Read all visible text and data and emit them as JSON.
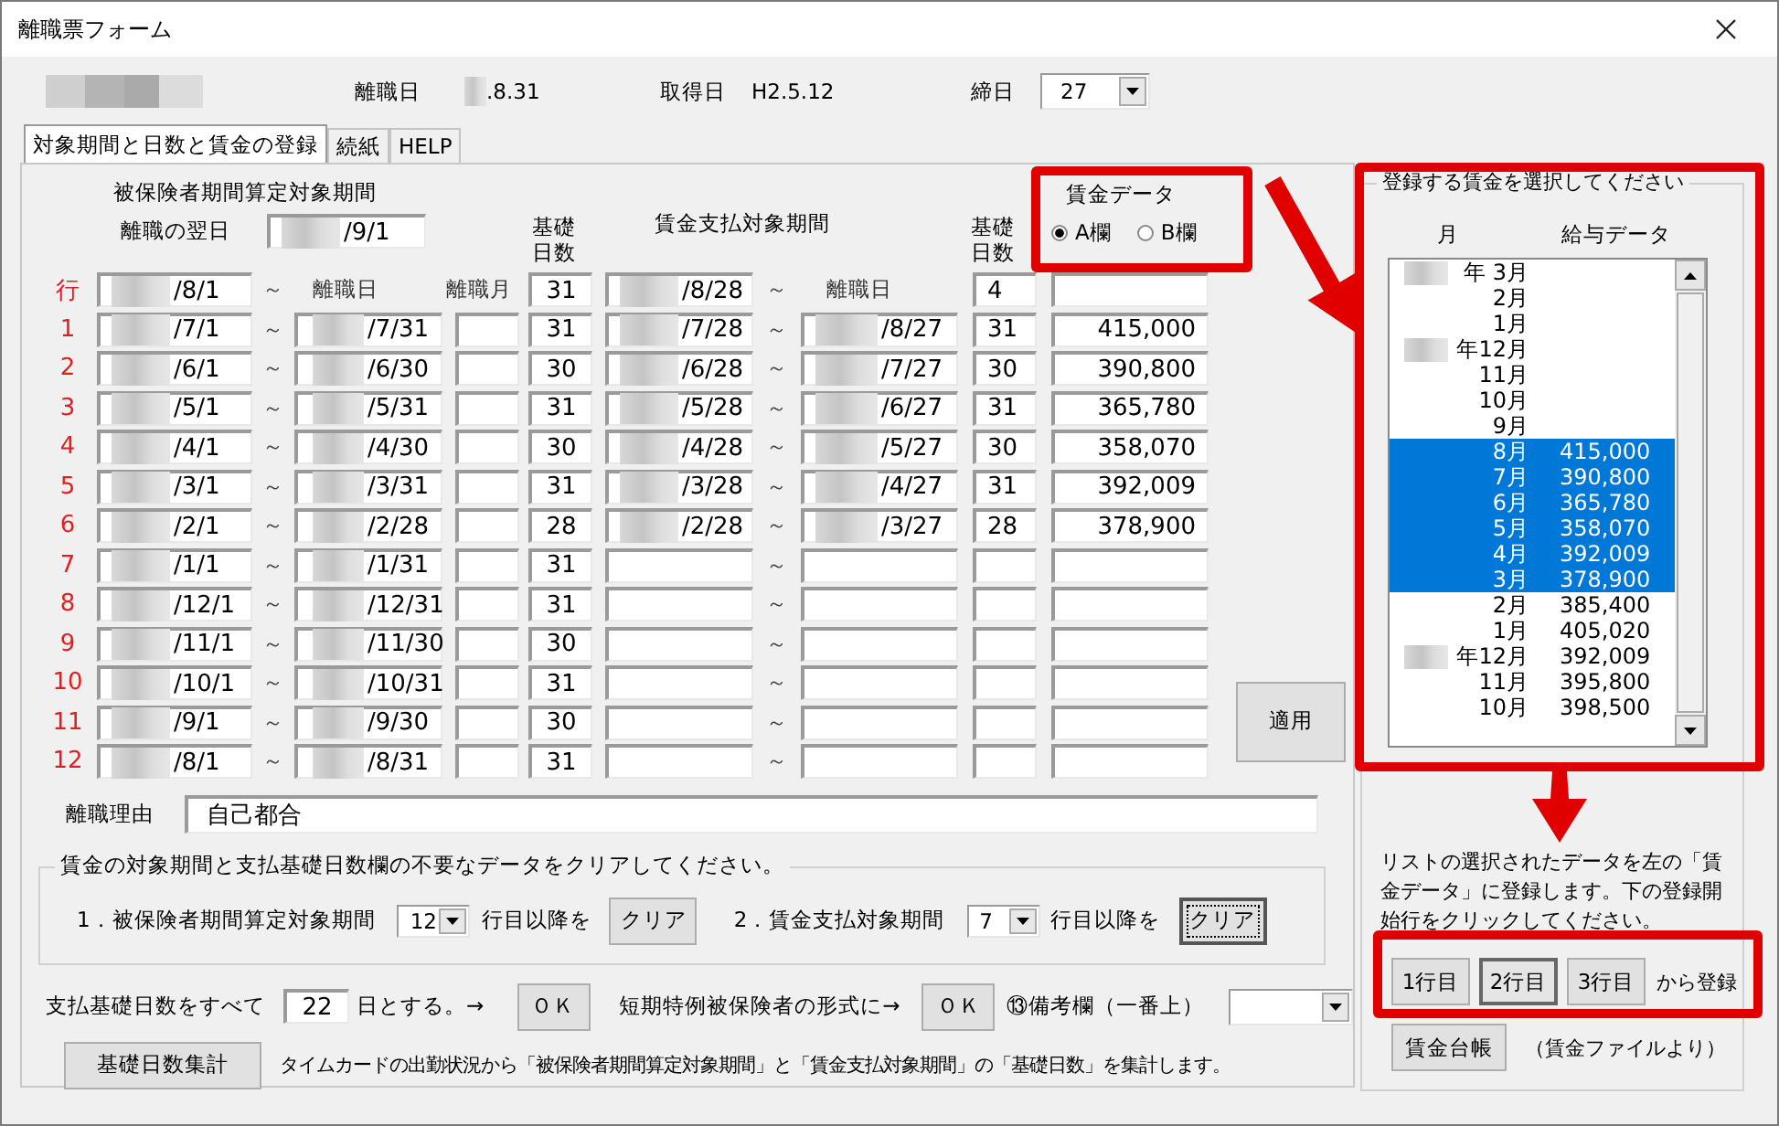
{
  "window": {
    "title": "離職票フォーム"
  },
  "header": {
    "separation_label": "離職日",
    "separation_date": ".8.31",
    "acquired_label": "取得日",
    "acquired_date": "H2.5.12",
    "closing_label": "締日",
    "closing_day": "27"
  },
  "tabs": [
    {
      "label": "対象期間と日数と賃金の登録",
      "selected": true
    },
    {
      "label": "続紙",
      "selected": false
    },
    {
      "label": "HELP",
      "selected": false
    }
  ],
  "period_heading": "被保険者期間算定対象期間",
  "next_day_label": "離職の翌日",
  "next_day": "/9/1",
  "days_heading": "基礎日数",
  "pay_period_heading": "賃金支払対象期間",
  "pay_days_heading": "基礎日数",
  "wage_data": {
    "title": "賃金データ",
    "options": [
      {
        "label": "A欄",
        "selected": true
      },
      {
        "label": "B欄",
        "selected": false
      }
    ]
  },
  "rows": [
    {
      "label": "行",
      "from": "/8/1",
      "from_sep": "～",
      "to_label": "離職日",
      "month_label": "離職月",
      "days": "31",
      "pay_from": "/8/28",
      "pay_sep": "～",
      "pay_to_label": "離職日",
      "pay_days": "4"
    },
    {
      "label": "1",
      "from": "/7/1",
      "from_sep": "～",
      "to": "/7/31",
      "days": "31",
      "pay_from": "/7/28",
      "pay_sep": "～",
      "pay_to": "/8/27",
      "pay_days": "31",
      "wage": "415,000"
    },
    {
      "label": "2",
      "from": "/6/1",
      "from_sep": "～",
      "to": "/6/30",
      "days": "30",
      "pay_from": "/6/28",
      "pay_sep": "～",
      "pay_to": "/7/27",
      "pay_days": "30",
      "wage": "390,800"
    },
    {
      "label": "3",
      "from": "/5/1",
      "from_sep": "～",
      "to": "/5/31",
      "days": "31",
      "pay_from": "/5/28",
      "pay_sep": "～",
      "pay_to": "/6/27",
      "pay_days": "31",
      "wage": "365,780"
    },
    {
      "label": "4",
      "from": "/4/1",
      "from_sep": "～",
      "to": "/4/30",
      "days": "30",
      "pay_from": "/4/28",
      "pay_sep": "～",
      "pay_to": "/5/27",
      "pay_days": "30",
      "wage": "358,070"
    },
    {
      "label": "5",
      "from": "/3/1",
      "from_sep": "～",
      "to": "/3/31",
      "days": "31",
      "pay_from": "/3/28",
      "pay_sep": "～",
      "pay_to": "/4/27",
      "pay_days": "31",
      "wage": "392,009"
    },
    {
      "label": "6",
      "from": "/2/1",
      "from_sep": "～",
      "to": "/2/28",
      "days": "28",
      "pay_from": "/2/28",
      "pay_sep": "～",
      "pay_to": "/3/27",
      "pay_days": "28",
      "wage": "378,900"
    },
    {
      "label": "7",
      "from": "/1/1",
      "from_sep": "～",
      "to": "/1/31",
      "days": "31",
      "pay_sep": "～"
    },
    {
      "label": "8",
      "from": "/12/1",
      "from_sep": "～",
      "to": "/12/31",
      "days": "31",
      "pay_sep": "～"
    },
    {
      "label": "9",
      "from": "/11/1",
      "from_sep": "～",
      "to": "/11/30",
      "days": "30",
      "pay_sep": "～"
    },
    {
      "label": "10",
      "from": "/10/1",
      "from_sep": "～",
      "to": "/10/31",
      "days": "31",
      "pay_sep": "～"
    },
    {
      "label": "11",
      "from": "/9/1",
      "from_sep": "～",
      "to": "/9/30",
      "days": "30",
      "pay_sep": "～"
    },
    {
      "label": "12",
      "from": "/8/1",
      "from_sep": "～",
      "to": "/8/31",
      "days": "31",
      "pay_sep": "～"
    }
  ],
  "apply_button": "適用",
  "reason_label": "離職理由",
  "reason": "自己都合",
  "clear_group": {
    "legend": "賃金の対象期間と支払基礎日数欄の不要なデータをクリアしてください。",
    "items": [
      {
        "label": "1．被保険者期間算定対象期間",
        "row": "12",
        "suffix": "行目以降を",
        "button": "クリア",
        "focused": false
      },
      {
        "label": "2．賃金支払対象期間",
        "row": "7",
        "suffix": "行目以降を",
        "button": "クリア",
        "focused": true
      }
    ]
  },
  "basis_days": {
    "label": "支払基礎日数をすべて",
    "value": "22",
    "suffix": "日とする。→",
    "button": "ＯＫ"
  },
  "short_term": {
    "label": "短期特例被保険者の形式に→",
    "button": "ＯＫ"
  },
  "remarks_label": "⑬備考欄（一番上）",
  "tally": {
    "button": "基礎日数集計",
    "note": "タイムカードの出勤状況から「被保険者期間算定対象期間」と「賃金支払対象期間」の「基礎日数」を集計します。"
  },
  "wage_list": {
    "legend": "登録する賃金を選択してください",
    "columns": [
      "月",
      "給与データ"
    ],
    "items": [
      {
        "kind": "year",
        "month": "年 3月",
        "selected": false
      },
      {
        "kind": "month",
        "month": "2月",
        "selected": false
      },
      {
        "kind": "month",
        "month": "1月",
        "selected": false
      },
      {
        "kind": "year",
        "month": "年12月",
        "selected": false
      },
      {
        "kind": "month",
        "month": "11月",
        "selected": false
      },
      {
        "kind": "month",
        "month": "10月",
        "selected": false
      },
      {
        "kind": "month",
        "month": "9月",
        "selected": false
      },
      {
        "kind": "month",
        "month": "8月",
        "value": "415,000",
        "selected": true
      },
      {
        "kind": "month",
        "month": "7月",
        "value": "390,800",
        "selected": true
      },
      {
        "kind": "month",
        "month": "6月",
        "value": "365,780",
        "selected": true
      },
      {
        "kind": "month",
        "month": "5月",
        "value": "358,070",
        "selected": true
      },
      {
        "kind": "month",
        "month": "4月",
        "value": "392,009",
        "selected": true
      },
      {
        "kind": "month",
        "month": "3月",
        "value": "378,900",
        "selected": true
      },
      {
        "kind": "month",
        "month": "2月",
        "value": "385,400",
        "selected": false
      },
      {
        "kind": "month",
        "month": "1月",
        "value": "405,020",
        "selected": false
      },
      {
        "kind": "year",
        "month": "年12月",
        "value": "392,009",
        "selected": false
      },
      {
        "kind": "month",
        "month": "11月",
        "value": "395,800",
        "selected": false
      },
      {
        "kind": "month",
        "month": "10月",
        "value": "398,500",
        "selected": false
      }
    ]
  },
  "register": {
    "instructions": "リストの選択されたデータを左の「賃金データ」に登録します。下の登録開始行をクリックしてください。",
    "buttons": [
      {
        "label": "1行目",
        "selected": false
      },
      {
        "label": "2行目",
        "selected": true
      },
      {
        "label": "3行目",
        "selected": false
      }
    ],
    "suffix": "から登録"
  },
  "ledger": {
    "button": "賃金台帳",
    "note": "（賃金ファイルより）"
  }
}
